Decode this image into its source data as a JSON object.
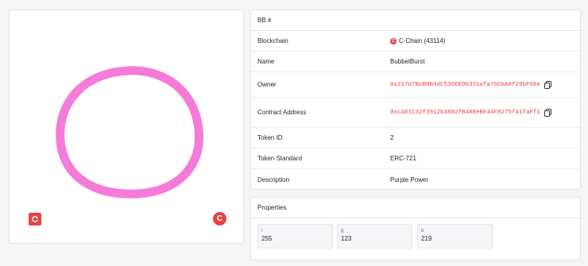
{
  "nft": {
    "title": "BB #",
    "ring_color": "#f57bd8"
  },
  "badges": {
    "left_icon": "refresh-icon",
    "right_label": "C"
  },
  "details": {
    "rows": [
      {
        "label": "Blockchain",
        "value": "C-Chain (43114)",
        "icon": "c-chain-icon",
        "icon_text": "C"
      },
      {
        "label": "Name",
        "value": "BubbelBurst"
      },
      {
        "label": "Owner",
        "value": "0x217d7BcB8B4dC536EED6331afa76CbA8f29bF66e",
        "copyable": true
      },
      {
        "label": "Contract Address",
        "value": "0xcA61C32f3912b3882fB488eBF44F8275f41faFf1",
        "copyable": true
      },
      {
        "label": "Token ID",
        "value": "2"
      },
      {
        "label": "Token Standard",
        "value": "ERC-721"
      },
      {
        "label": "Description",
        "value": "Purple Power"
      }
    ]
  },
  "properties": {
    "title": "Properties",
    "items": [
      {
        "key": "r",
        "value": "255"
      },
      {
        "key": "g",
        "value": "123"
      },
      {
        "key": "b",
        "value": "219"
      }
    ]
  },
  "colors": {
    "accent": "#e84142",
    "background": "#f4f5f7",
    "card": "#ffffff",
    "ring": "#f57bd8"
  }
}
